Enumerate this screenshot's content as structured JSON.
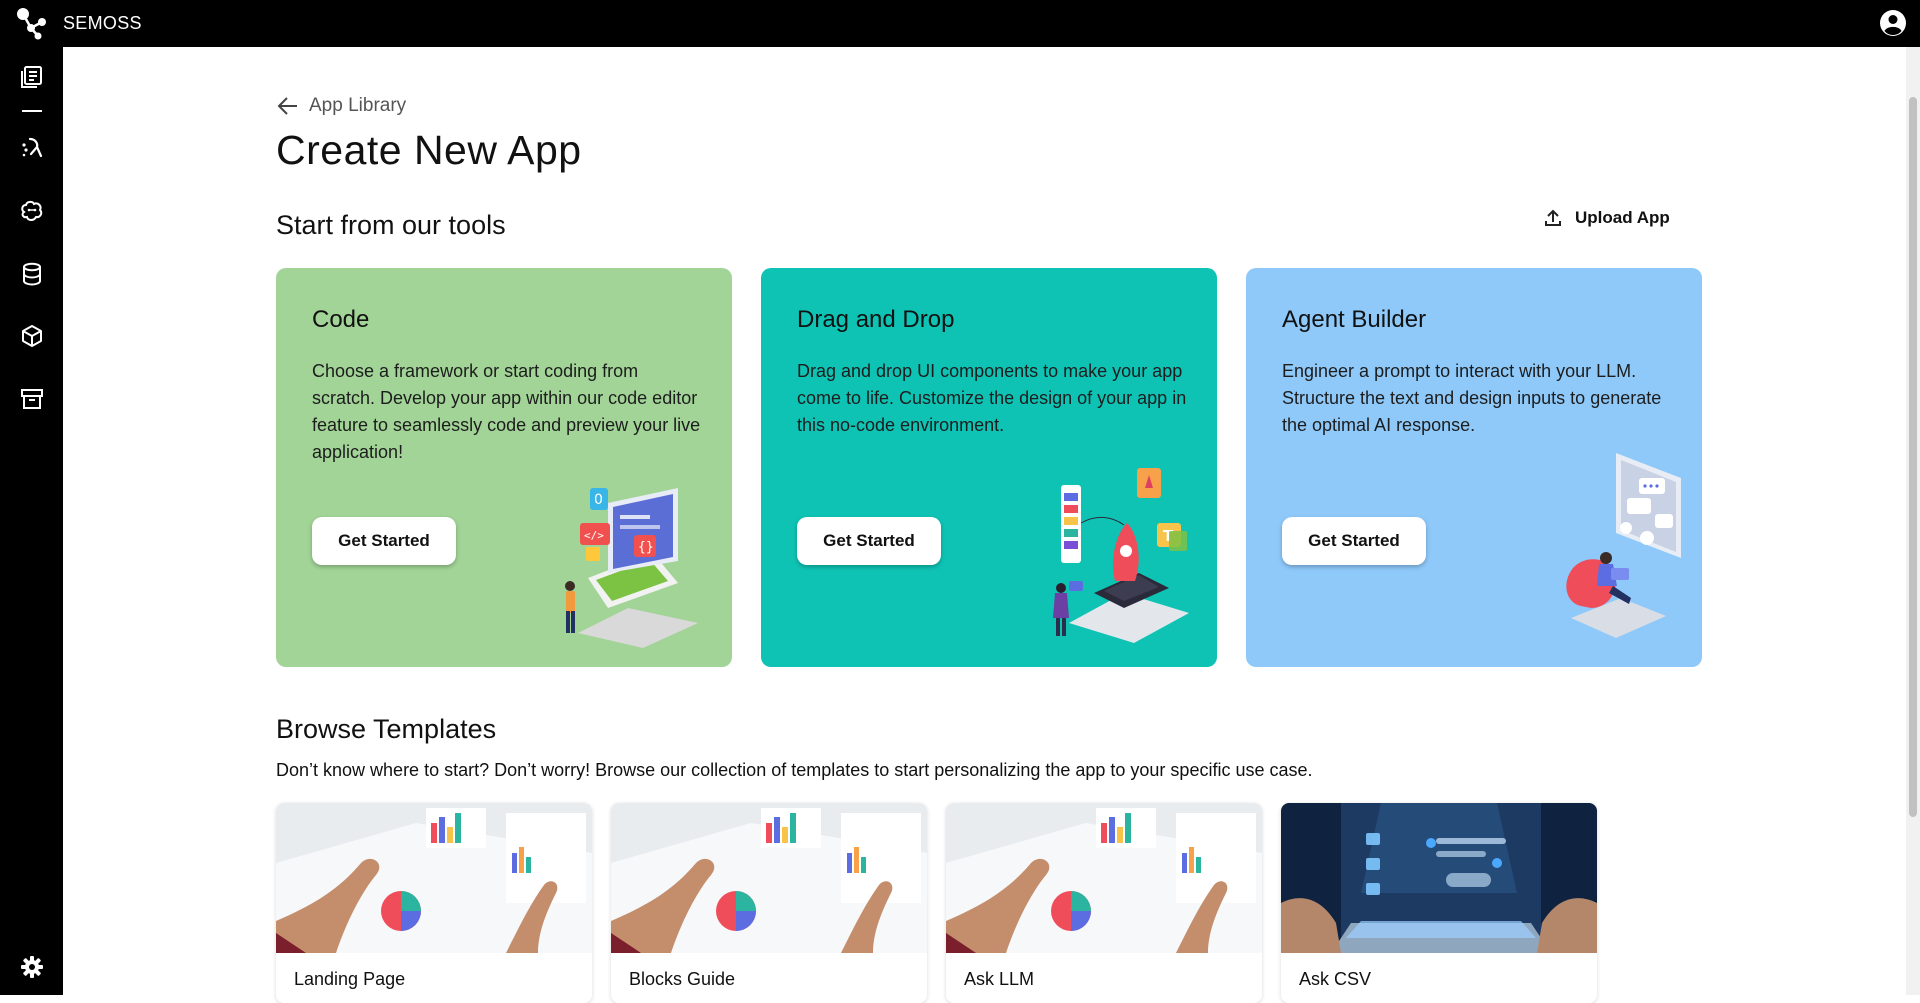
{
  "app": {
    "brand_name": "SEMOSS"
  },
  "sidebar": {
    "items": [
      {
        "name": "app-library",
        "icon": "library-icon"
      },
      {
        "name": "build",
        "icon": "build-icon"
      },
      {
        "name": "models",
        "icon": "brain-icon"
      },
      {
        "name": "databases",
        "icon": "database-icon"
      },
      {
        "name": "storage",
        "icon": "cube-icon"
      },
      {
        "name": "archive",
        "icon": "archive-icon"
      }
    ],
    "settings_icon": "gear-icon"
  },
  "breadcrumb": {
    "label": "App Library"
  },
  "page_title": "Create New App",
  "tools_section": {
    "title": "Start from our tools",
    "upload_label": "Upload App",
    "cards": [
      {
        "title": "Code",
        "description": "Choose a framework or start coding from scratch. Develop your app within our code editor feature to seamlessly code and preview your live application!",
        "button": "Get Started",
        "color": "#a1d496"
      },
      {
        "title": "Drag and Drop",
        "description": "Drag and drop UI components to make your app come to life. Customize the design of your app in this no-code environment.",
        "button": "Get Started",
        "color": "#0ec3b4"
      },
      {
        "title": "Agent Builder",
        "description": "Engineer a prompt to interact with your LLM. Structure the text and design inputs to generate the optimal AI response.",
        "button": "Get Started",
        "color": "#8ec9fa"
      }
    ]
  },
  "templates_section": {
    "title": "Browse Templates",
    "description": "Don’t know where to start? Don’t worry! Browse our collection of templates to start personalizing the app to your specific use case.",
    "templates": [
      {
        "name": "Landing Page"
      },
      {
        "name": "Blocks Guide"
      },
      {
        "name": "Ask LLM"
      },
      {
        "name": "Ask CSV"
      }
    ]
  }
}
